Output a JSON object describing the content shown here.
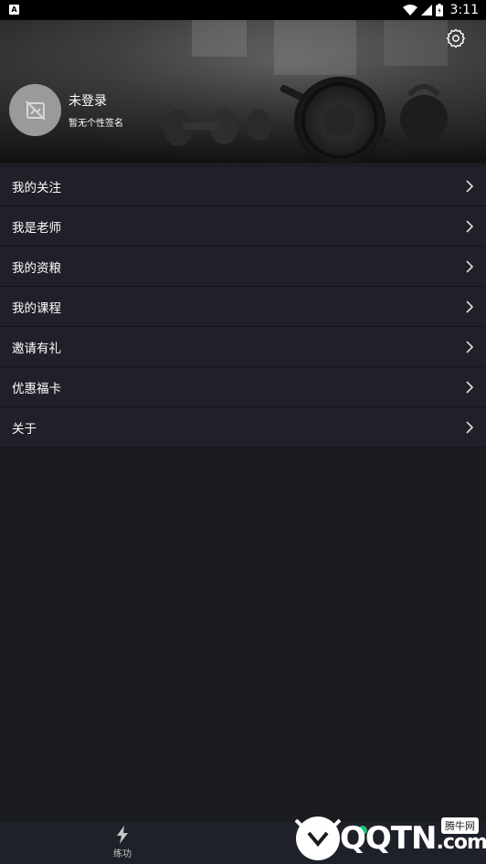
{
  "status_bar": {
    "time": "3:11",
    "app_letter": "A"
  },
  "profile": {
    "username": "未登录",
    "signature": "暂无个性签名"
  },
  "menu": [
    {
      "label": "我的关注"
    },
    {
      "label": "我是老师"
    },
    {
      "label": "我的资粮"
    },
    {
      "label": "我的课程"
    },
    {
      "label": "邀请有礼"
    },
    {
      "label": "优惠福卡"
    },
    {
      "label": "关于"
    }
  ],
  "bottom_nav": {
    "practice_label": "练功"
  },
  "watermark": {
    "text": "QQTN",
    "suffix": ".com",
    "badge": "腾牛网"
  }
}
